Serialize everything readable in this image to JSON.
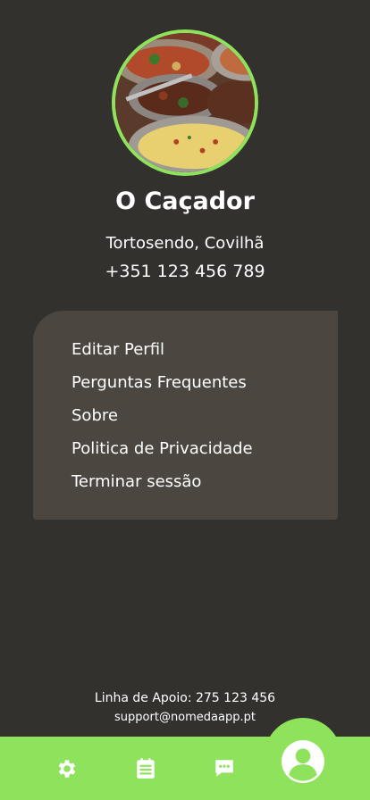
{
  "profile": {
    "name": "O Caçador",
    "location": "Tortosendo, Covilhã",
    "phone": "+351 123 456 789"
  },
  "menu": {
    "items": [
      {
        "label": "Editar Perfil"
      },
      {
        "label": "Perguntas Frequentes"
      },
      {
        "label": "Sobre"
      },
      {
        "label": "Politica de Privacidade"
      },
      {
        "label": "Terminar sessão"
      }
    ]
  },
  "support": {
    "phone_line": "Linha de Apoio: 275 123 456",
    "email": "support@nomedaapp.pt"
  },
  "bottom_nav": {
    "items": [
      "gear-icon",
      "list-icon",
      "chat-icon",
      "user-icon"
    ]
  },
  "colors": {
    "background": "#32312d",
    "card": "#4b4740",
    "accent": "#8fe35c",
    "text": "#ffffff"
  }
}
